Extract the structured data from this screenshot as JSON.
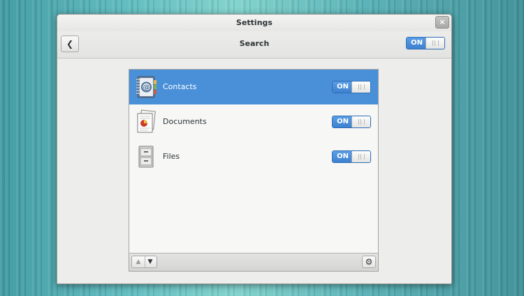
{
  "window": {
    "title": "Settings",
    "close_glyph": "×"
  },
  "toolbar": {
    "back_icon": "chevron-left-icon",
    "back_glyph": "❮",
    "title": "Search",
    "master_switch": {
      "state": true,
      "on_label": "ON"
    }
  },
  "search_providers": [
    {
      "label": "Contacts",
      "icon": "contacts-address-book-icon",
      "selected": true,
      "enabled": true,
      "switch_label": "ON"
    },
    {
      "label": "Documents",
      "icon": "documents-icon",
      "selected": false,
      "enabled": true,
      "switch_label": "ON"
    },
    {
      "label": "Files",
      "icon": "file-cabinet-icon",
      "selected": false,
      "enabled": true,
      "switch_label": "ON"
    }
  ],
  "bottombar": {
    "move_up_glyph": "▲",
    "move_down_glyph": "▼",
    "gear_glyph": "⚙"
  },
  "colors": {
    "selection": "#4a90d9",
    "switch_on": "#3d80cf"
  }
}
